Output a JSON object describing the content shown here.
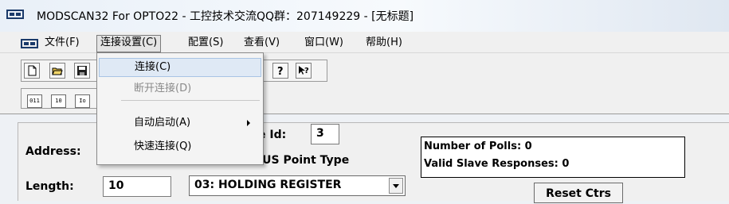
{
  "window": {
    "title": "MODSCAN32 For OPTO22 - 工控技术交流QQ群：207149229 - [无标题]"
  },
  "menubar": {
    "items": [
      {
        "label": "文件(F)"
      },
      {
        "label": "连接设置(C)"
      },
      {
        "label": "配置(S)"
      },
      {
        "label": "查看(V)"
      },
      {
        "label": "窗口(W)"
      },
      {
        "label": "帮助(H)"
      }
    ]
  },
  "dropdown": {
    "items": [
      {
        "label": "连接(C)"
      },
      {
        "label": "断开连接(D)"
      },
      {
        "label": "自动启动(A)"
      },
      {
        "label": "快速连接(Q)"
      }
    ]
  },
  "toolbar": {
    "icons": [
      "new-file-icon",
      "open-folder-icon",
      "save-icon",
      "help-icon",
      "context-help-icon"
    ],
    "display_buttons": [
      "011",
      "10",
      "Io"
    ]
  },
  "form": {
    "address_label": "Address:",
    "length_label": "Length:",
    "length_value": "10",
    "device_id_label": "e Id:",
    "device_id_value": "3",
    "point_type_label": "MODBUS Point Type",
    "point_type_value": "03: HOLDING REGISTER"
  },
  "stats": {
    "polls_label": "Number of Polls: 0",
    "responses_label": "Valid Slave Responses: 0"
  },
  "buttons": {
    "reset_label": "Reset Ctrs"
  },
  "colors": {
    "menu_highlight": "#dfe9f5",
    "disabled_text": "#8a8a8a",
    "title_bar": "#e9f0f8"
  }
}
